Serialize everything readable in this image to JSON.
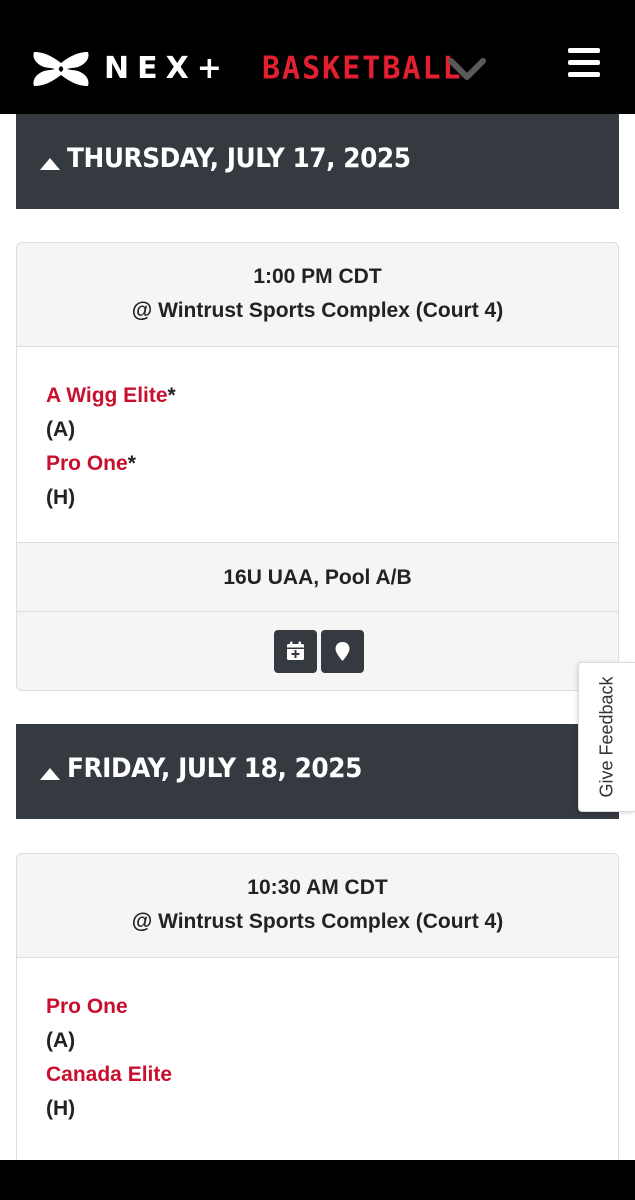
{
  "header": {
    "logo_icon": "under-armour-logo",
    "nex_label": "NEX+",
    "section_label": "BASKETBALL",
    "dropdown_icon": "chevron-down-icon",
    "menu_icon": "hamburger-menu-icon",
    "accent_color": "#e3202f"
  },
  "days": [
    {
      "label": "THURSDAY, JULY 17, 2025",
      "expanded": true,
      "games": [
        {
          "time": "1:00 PM CDT",
          "location": "@ Wintrust Sports Complex  (Court 4)",
          "away_team": "A Wigg Elite",
          "away_marker": "*",
          "away_designation": "(A)",
          "home_team": "Pro One",
          "home_marker": "*",
          "home_designation": "(H)",
          "division": "16U UAA, Pool A/B",
          "actions": [
            "calendar-add-icon",
            "map-pin-icon"
          ]
        }
      ]
    },
    {
      "label": "FRIDAY, JULY 18, 2025",
      "expanded": true,
      "games": [
        {
          "time": "10:30 AM CDT",
          "location": "@ Wintrust Sports Complex  (Court 4)",
          "away_team": "Pro One",
          "away_designation": "(A)",
          "home_team": "Canada Elite",
          "home_designation": "(H)"
        }
      ]
    }
  ],
  "feedback": {
    "label": "Give Feedback"
  },
  "colors": {
    "team_link": "#c8102e",
    "day_header_bg": "#353940",
    "card_bg": "#f5f5f5"
  }
}
